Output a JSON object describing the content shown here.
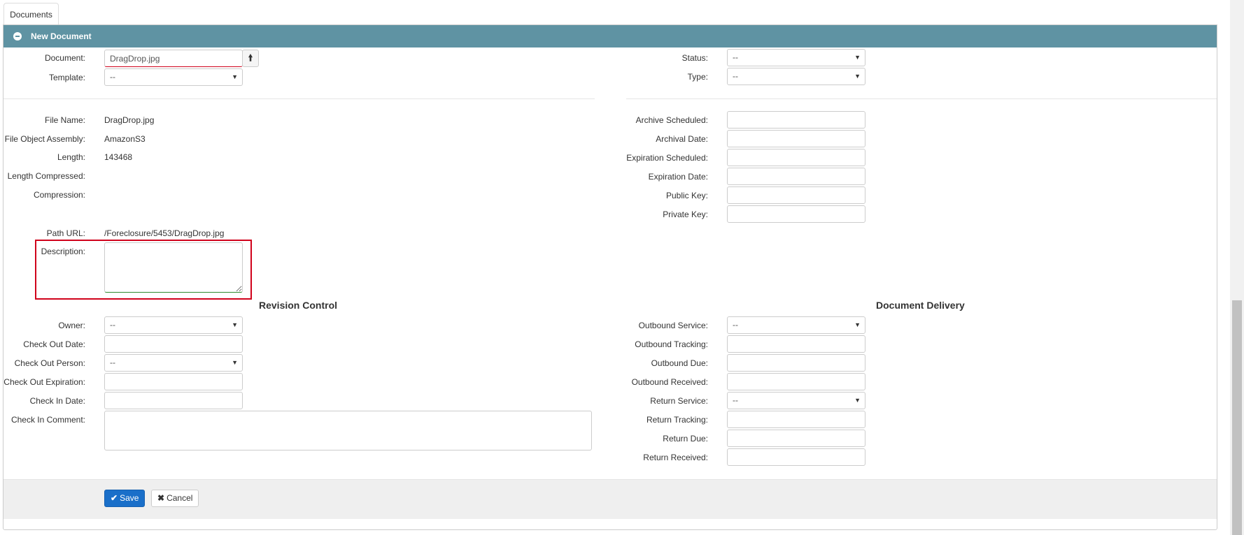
{
  "tab": {
    "label": "Documents"
  },
  "panel": {
    "title": "New Document"
  },
  "top": {
    "document_label": "Document:",
    "document_value": "DragDrop.jpg",
    "template_label": "Template:",
    "template_value": "--",
    "status_label": "Status:",
    "status_value": "--",
    "type_label": "Type:",
    "type_value": "--"
  },
  "file_info": {
    "file_name_label": "File Name:",
    "file_name_value": "DragDrop.jpg",
    "assembly_label": "File Object Assembly:",
    "assembly_value": "AmazonS3",
    "length_label": "Length:",
    "length_value": "143468",
    "length_compressed_label": "Length Compressed:",
    "compression_label": "Compression:",
    "path_label": "Path URL:",
    "path_value": "/Foreclosure/5453/DragDrop.jpg",
    "description_label": "Description:"
  },
  "archive": {
    "archive_scheduled_label": "Archive Scheduled:",
    "archival_date_label": "Archival Date:",
    "expiration_scheduled_label": "Expiration Scheduled:",
    "expiration_date_label": "Expiration Date:",
    "public_key_label": "Public Key:",
    "private_key_label": "Private Key:"
  },
  "revision": {
    "title": "Revision Control",
    "owner_label": "Owner:",
    "owner_value": "--",
    "check_out_date_label": "Check Out Date:",
    "check_out_person_label": "Check Out Person:",
    "check_out_person_value": "--",
    "check_out_expiration_label": "Check Out Expiration:",
    "check_in_date_label": "Check In Date:",
    "check_in_comment_label": "Check In Comment:"
  },
  "delivery": {
    "title": "Document Delivery",
    "outbound_service_label": "Outbound Service:",
    "outbound_service_value": "--",
    "outbound_tracking_label": "Outbound Tracking:",
    "outbound_due_label": "Outbound Due:",
    "outbound_received_label": "Outbound Received:",
    "return_service_label": "Return Service:",
    "return_service_value": "--",
    "return_tracking_label": "Return Tracking:",
    "return_due_label": "Return Due:",
    "return_received_label": "Return Received:"
  },
  "footer": {
    "save_label": "Save",
    "cancel_label": "Cancel"
  },
  "colors": {
    "header": "#5f93a3",
    "primary": "#1a6fc9",
    "highlight": "#d0021b"
  }
}
